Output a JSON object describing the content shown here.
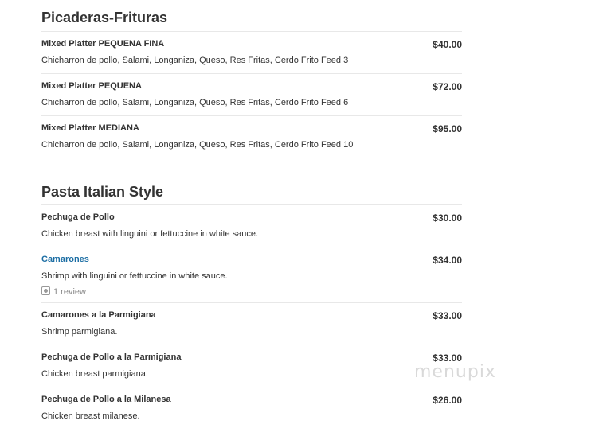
{
  "sections": [
    {
      "title": "Picaderas-Frituras",
      "items": [
        {
          "name": "Mixed Platter PEQUENA FINA",
          "price": "$40.00",
          "desc": "Chicharron de pollo, Salami, Longaniza, Queso, Res Fritas, Cerdo Frito Feed 3"
        },
        {
          "name": "Mixed Platter PEQUENA",
          "price": "$72.00",
          "desc": "Chicharron de pollo, Salami, Longaniza, Queso, Res Fritas, Cerdo Frito Feed 6"
        },
        {
          "name": "Mixed Platter MEDIANA",
          "price": "$95.00",
          "desc": "Chicharron de pollo, Salami, Longaniza, Queso, Res Fritas, Cerdo Frito Feed 10"
        }
      ]
    },
    {
      "title": "Pasta Italian Style",
      "items": [
        {
          "name": "Pechuga de Pollo",
          "price": "$30.00",
          "desc": "Chicken breast with linguini or fettuccine in white sauce."
        },
        {
          "name": "Camarones",
          "price": "$34.00",
          "desc": "Shrimp with linguini or fettuccine in white sauce.",
          "review": "1 review"
        },
        {
          "name": "Camarones a la Parmigiana",
          "price": "$33.00",
          "desc": "Shrimp parmigiana."
        },
        {
          "name": "Pechuga de Pollo a la Parmigiana",
          "price": "$33.00",
          "desc": "Chicken breast parmigiana."
        },
        {
          "name": "Pechuga de Pollo a la Milanesa",
          "price": "$26.00",
          "desc": "Chicken breast milanese."
        }
      ]
    }
  ],
  "watermark": "menupix"
}
